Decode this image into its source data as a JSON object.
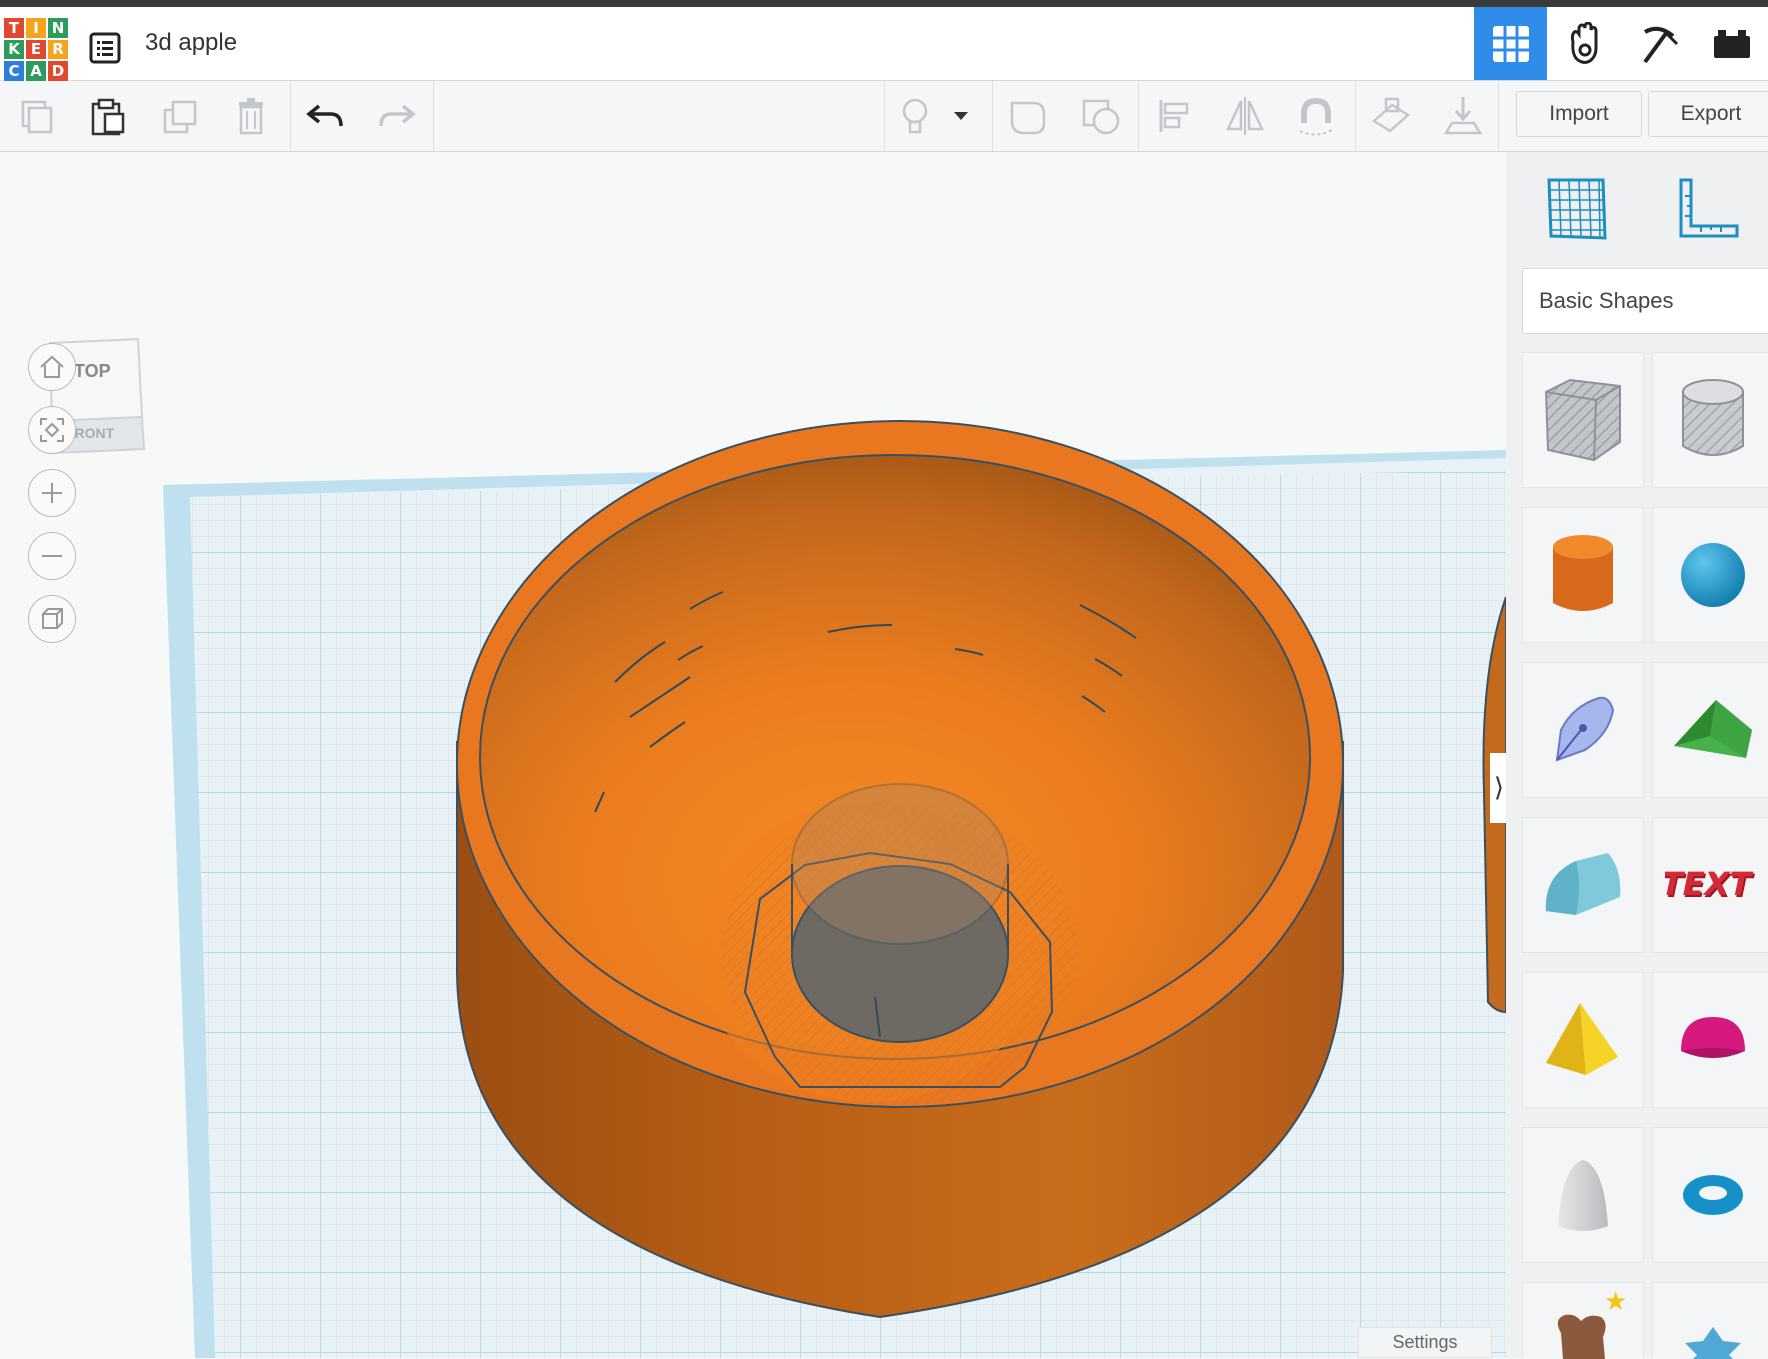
{
  "app": {
    "logo_letters": [
      "T",
      "I",
      "N",
      "K",
      "E",
      "R",
      "C",
      "A",
      "D"
    ],
    "logo_colors": [
      "#e0482f",
      "#f7a41d",
      "#2c9b5b",
      "#2c9b5b",
      "#e0482f",
      "#f7a41d",
      "#2f7fd6",
      "#2c9b5b",
      "#e0482f"
    ],
    "design_name": "3d apple"
  },
  "header": {
    "modes": [
      {
        "name": "3d-design",
        "icon": "grid-icon",
        "active": true
      },
      {
        "name": "blocks",
        "icon": "hand-icon",
        "active": false
      },
      {
        "name": "lego-bricks",
        "icon": "pickaxe-icon",
        "active": false
      },
      {
        "name": "codeblocks",
        "icon": "brick-icon",
        "active": false
      }
    ]
  },
  "toolbar": {
    "left_tools": [
      "copy",
      "paste",
      "duplicate",
      "delete",
      "undo",
      "redo"
    ],
    "right_tools": [
      "notes-light",
      "notes-dropdown",
      "group",
      "ungroup",
      "align",
      "mirror",
      "cruise",
      "workplane",
      "drop"
    ],
    "import_label": "Import",
    "export_label": "Export"
  },
  "viewport": {
    "navcube": {
      "top_label": "TOP",
      "front_label": "FRONT"
    },
    "controls": [
      "home",
      "fit-all",
      "zoom-in",
      "zoom-out",
      "perspective"
    ],
    "settings_label": "Settings",
    "workplane_color": "#cfe4ee",
    "shape_color": "#e9771f"
  },
  "panel": {
    "tools": [
      "workplane-tool",
      "ruler-tool"
    ],
    "category": "Basic Shapes",
    "shapes": [
      {
        "name": "box-hole",
        "color": "#b5b9bf"
      },
      {
        "name": "cylinder-hole",
        "color": "#b5b9bf"
      },
      {
        "name": "cylinder",
        "color": "#e8771f"
      },
      {
        "name": "sphere",
        "color": "#1f9fd6"
      },
      {
        "name": "scribble",
        "color": "#8ea4e0"
      },
      {
        "name": "roof",
        "color": "#3da93f"
      },
      {
        "name": "round-roof",
        "color": "#6ec6d8"
      },
      {
        "name": "text",
        "color": "#c8232e"
      },
      {
        "name": "pyramid",
        "color": "#f2c91c"
      },
      {
        "name": "half-sphere",
        "color": "#d6197f"
      },
      {
        "name": "paraboloid",
        "color": "#cfd1d3"
      },
      {
        "name": "torus",
        "color": "#1f9fd6"
      },
      {
        "name": "heart",
        "color": "#8b5a3c"
      },
      {
        "name": "star",
        "color": "#4fa8d6"
      }
    ]
  }
}
